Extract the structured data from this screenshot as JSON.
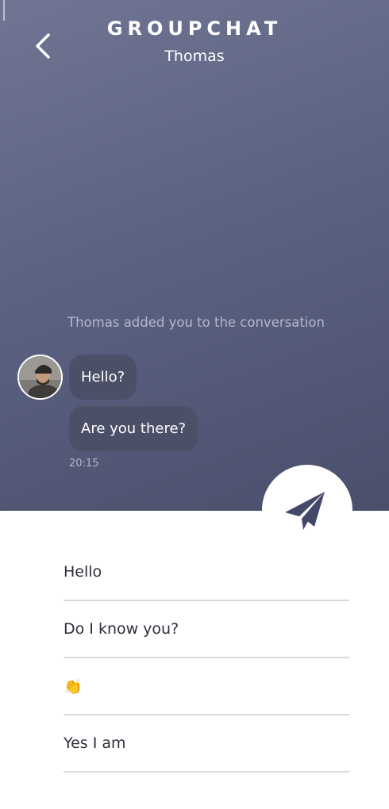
{
  "header": {
    "title": "GROUPCHAT",
    "subtitle": "Thomas",
    "back_icon": "chevron-left-icon"
  },
  "chat": {
    "system_message": "Thomas added you to the conversation",
    "messages": [
      {
        "text": "Hello?"
      },
      {
        "text": "Are you there?"
      }
    ],
    "timestamp": "20:15",
    "avatar_icon": "user-avatar-photo"
  },
  "send_button": {
    "icon": "paper-plane-icon"
  },
  "quick_replies": [
    {
      "text": "Hello"
    },
    {
      "text": "Do I know you?"
    },
    {
      "text": "👏"
    },
    {
      "text": "Yes I am"
    }
  ],
  "colors": {
    "header_gradient_start": "#6f7592",
    "header_gradient_end": "#4a4f6c",
    "bubble": "#4b5068",
    "send_icon": "#44496a",
    "reply_text": "#2d2e3a",
    "divider": "#d9d9dd"
  }
}
